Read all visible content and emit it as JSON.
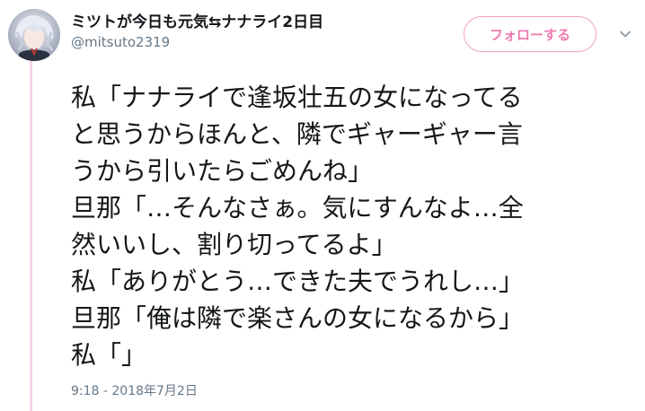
{
  "user": {
    "display_name": "ミツトが今日も元気⇆ナナライ2日目",
    "handle": "@mitsuto2319"
  },
  "actions": {
    "follow_label": "フォローする"
  },
  "tweet": {
    "lines": [
      "私「ナナライで逢坂壮五の女になってる",
      "と思うからほんと、隣でギャーギャー言",
      "うから引いたらごめんね」",
      "旦那「…そんなさぁ。気にすんなよ…全",
      "然いいし、割り切ってるよ」",
      "私「ありがとう…できた夫でうれし…」",
      "旦那「俺は隣で楽さんの女になるから」",
      "私「」"
    ],
    "timestamp": "9:18 - 2018年7月2日"
  },
  "colors": {
    "accent": "#f07aae",
    "follow_border": "#f3a0c6",
    "thread_line": "#f7d3e6",
    "secondary_text": "#657786"
  }
}
